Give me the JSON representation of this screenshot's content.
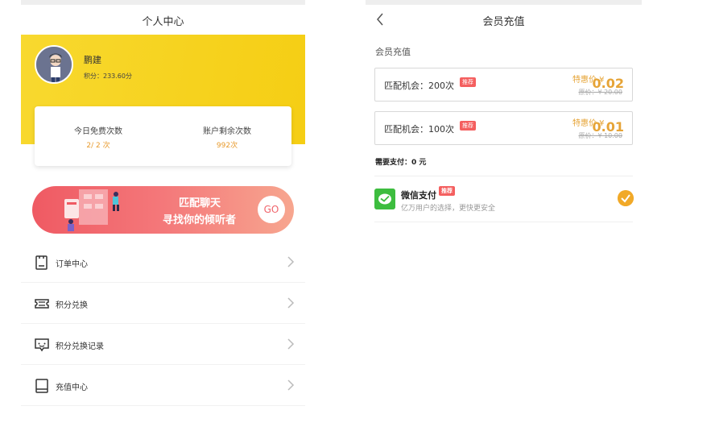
{
  "left": {
    "title": "个人中心",
    "user": {
      "name": "鹏建",
      "points": "积分：233.60分"
    },
    "stats": [
      {
        "label": "今日免费次数",
        "value": "2/ 2 次"
      },
      {
        "label": "账户剩余次数",
        "value": "992次"
      }
    ],
    "banner": {
      "line1": "匹配聊天",
      "line2": "寻找你的倾听者",
      "go": "GO"
    },
    "menu": [
      {
        "label": "订单中心",
        "icon": "clipboard-icon"
      },
      {
        "label": "积分兑换",
        "icon": "ticket-icon"
      },
      {
        "label": "积分兑换记录",
        "icon": "chat-record-icon"
      },
      {
        "label": "充值中心",
        "icon": "book-icon"
      }
    ]
  },
  "right": {
    "title": "会员充值",
    "section_label": "会员充值",
    "options": [
      {
        "name": "匹配机会：200次",
        "tag": "推荐",
        "special": "特惠价 ¥",
        "price": "0.02",
        "original": "原价：¥ 20.00"
      },
      {
        "name": "匹配机会：100次",
        "tag": "推荐",
        "special": "特惠价 ¥",
        "price": "0.01",
        "original": "原价：¥ 10.00"
      }
    ],
    "pay_amount": "需要支付：0 元",
    "wechat": {
      "name": "微信支付",
      "tag": "推荐",
      "desc": "亿万用户的选择，更快更安全"
    }
  },
  "colors": {
    "yellow": "#f6d21e",
    "accent": "#e6a437",
    "wechat_green": "#3dbd3f",
    "tag_red": "#f45f5f"
  }
}
